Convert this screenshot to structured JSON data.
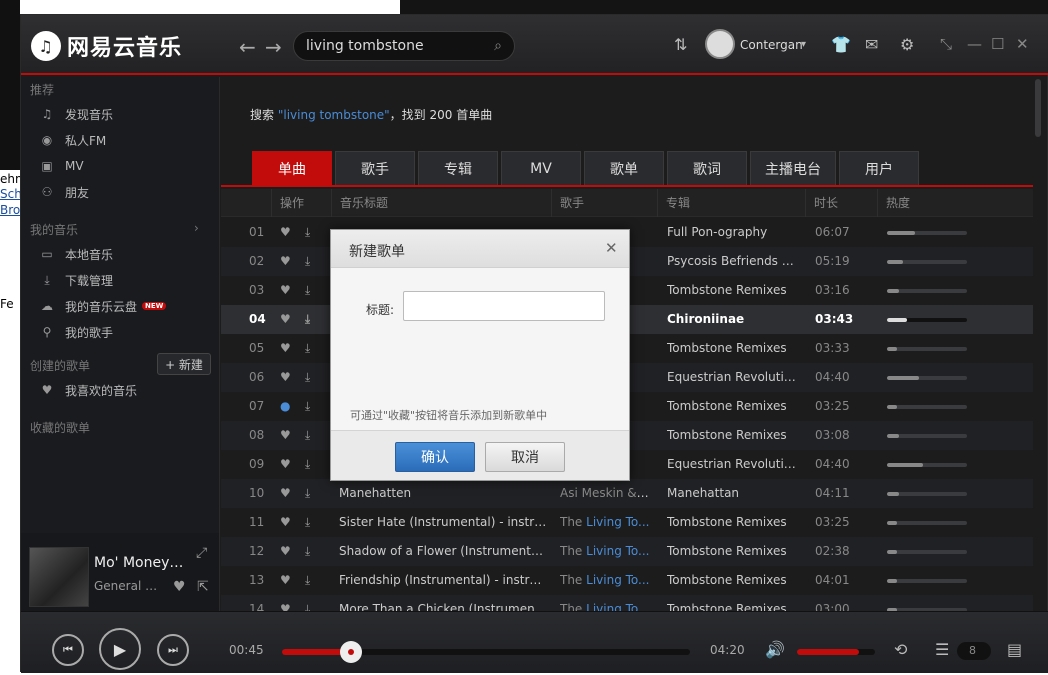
{
  "background": {
    "frag_texts": [
      "ehm",
      "Sch",
      "Bro",
      "Fe"
    ]
  },
  "app": {
    "logo": "网易云音乐",
    "user": "Contergan",
    "accent": "#c20c0c"
  },
  "search": {
    "value": "living tombstone"
  },
  "sidebar": {
    "section_recommend": "推荐",
    "recommend_items": [
      {
        "label": "发现音乐",
        "icon": "music-note-icon"
      },
      {
        "label": "私人FM",
        "icon": "radio-icon"
      },
      {
        "label": "MV",
        "icon": "video-icon"
      },
      {
        "label": "朋友",
        "icon": "friends-icon"
      }
    ],
    "section_my_music": "我的音乐",
    "my_music_items": [
      {
        "label": "本地音乐",
        "icon": "computer-icon"
      },
      {
        "label": "下载管理",
        "icon": "download-icon"
      },
      {
        "label": "我的音乐云盘",
        "icon": "cloud-icon",
        "badge": "NEW"
      },
      {
        "label": "我的歌手",
        "icon": "singer-icon"
      }
    ],
    "section_created": "创建的歌单",
    "new_playlist_label": "+ 新建",
    "created_items": [
      {
        "label": "我喜欢的音乐",
        "icon": "heart-icon"
      }
    ],
    "section_collected": "收藏的歌单"
  },
  "now_playing": {
    "title": "Mo' Money f...",
    "artist": "General M..."
  },
  "summary": {
    "prefix": "搜索",
    "query": "\"living tombstone\"",
    "suffix": "，找到 200 首单曲"
  },
  "tabs": [
    "单曲",
    "歌手",
    "专辑",
    "MV",
    "歌单",
    "歌词",
    "主播电台",
    "用户"
  ],
  "table": {
    "headers": [
      "操作",
      "音乐标题",
      "歌手",
      "专辑",
      "时长",
      "热度"
    ],
    "rows": [
      {
        "num": "01",
        "title": "",
        "artist_pre": "",
        "artist_link": "",
        "album": "Full Pon-ography",
        "duration": "06:07",
        "heat": 0.35
      },
      {
        "num": "02",
        "title": "",
        "artist_pre": "",
        "artist_link": "",
        "album": "Psycosis Befriends N...",
        "duration": "05:19",
        "heat": 0.2
      },
      {
        "num": "03",
        "title": "",
        "artist_pre": "",
        "artist_link": "",
        "album": "Tombstone Remixes",
        "duration": "03:16",
        "heat": 0.15
      },
      {
        "num": "04",
        "title": "",
        "artist_pre": "",
        "artist_link": "",
        "album": "Chironiinae",
        "duration": "03:43",
        "heat": 0.25
      },
      {
        "num": "05",
        "title": "",
        "artist_pre": "",
        "artist_link": "",
        "album": "Tombstone Remixes",
        "duration": "03:33",
        "heat": 0.12
      },
      {
        "num": "06",
        "title": "",
        "artist_pre": "",
        "artist_link": "",
        "album": "Equestrian Revolution...",
        "duration": "04:40",
        "heat": 0.4
      },
      {
        "num": "07",
        "title": "",
        "artist_pre": "",
        "artist_link": "",
        "album": "Tombstone Remixes",
        "duration": "03:25",
        "heat": 0.12
      },
      {
        "num": "08",
        "title": "",
        "artist_pre": "",
        "artist_link": "",
        "album": "Tombstone Remixes",
        "duration": "03:08",
        "heat": 0.15
      },
      {
        "num": "09",
        "title": "",
        "artist_pre": "",
        "artist_link": "",
        "album": "Equestrian Revolution...",
        "duration": "04:40",
        "heat": 0.45
      },
      {
        "num": "10",
        "title": "Manehatten",
        "artist_pre": "Asi Meskin & ...",
        "artist_link": "",
        "album": "Manehattan",
        "duration": "04:11",
        "heat": 0.15
      },
      {
        "num": "11",
        "title": "Sister Hate (Instrumental) - instru...",
        "artist_pre": "The ",
        "artist_link": "Living To...",
        "album": "Tombstone Remixes",
        "duration": "03:25",
        "heat": 0.12
      },
      {
        "num": "12",
        "title": "Shadow of a Flower (Instrumental) ...",
        "artist_pre": "The ",
        "artist_link": "Living To...",
        "album": "Tombstone Remixes",
        "duration": "02:38",
        "heat": 0.12
      },
      {
        "num": "13",
        "title": "Friendship (Instrumental) - instrum...",
        "artist_pre": "The ",
        "artist_link": "Living To...",
        "album": "Tombstone Remixes",
        "duration": "04:01",
        "heat": 0.12
      },
      {
        "num": "14",
        "title": "More Than a Chicken (Instrumental...",
        "artist_pre": "The ",
        "artist_link": "Living To...",
        "album": "Tombstone Remixes",
        "duration": "03:00",
        "heat": 0.12
      }
    ]
  },
  "player": {
    "current_time": "00:45",
    "total_time": "04:20",
    "progress": 0.17,
    "volume": 0.8,
    "queue_count": "8"
  },
  "dialog": {
    "title": "新建歌单",
    "label": "标题:",
    "value": "",
    "hint": "可通过\"收藏\"按钮将音乐添加到新歌单中",
    "ok_label": "确认",
    "cancel_label": "取消"
  }
}
